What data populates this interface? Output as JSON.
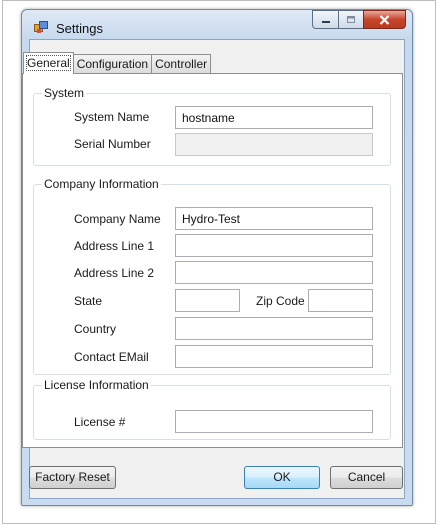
{
  "window": {
    "title": "Settings"
  },
  "tabs": [
    "General",
    "Configuration",
    "Controller"
  ],
  "system": {
    "legend": "System",
    "system_name_label": "System Name",
    "system_name_value": "hostname",
    "serial_number_label": "Serial Number",
    "serial_number_value": ""
  },
  "company": {
    "legend": "Company Information",
    "company_name_label": "Company Name",
    "company_name_value": "Hydro-Test",
    "address1_label": "Address Line 1",
    "address1_value": "",
    "address2_label": "Address Line 2",
    "address2_value": "",
    "state_label": "State",
    "state_value": "",
    "zip_label": "Zip Code",
    "zip_value": "",
    "country_label": "Country",
    "country_value": "",
    "email_label": "Contact EMail",
    "email_value": ""
  },
  "license": {
    "legend": "License Information",
    "license_label": "License #",
    "license_value": ""
  },
  "buttons": {
    "factory_reset": "Factory Reset",
    "ok": "OK",
    "cancel": "Cancel"
  },
  "icons": {
    "app": "settings-window-icon",
    "minimize": "minimize-icon",
    "maximize": "maximize-icon",
    "close": "close-icon"
  }
}
